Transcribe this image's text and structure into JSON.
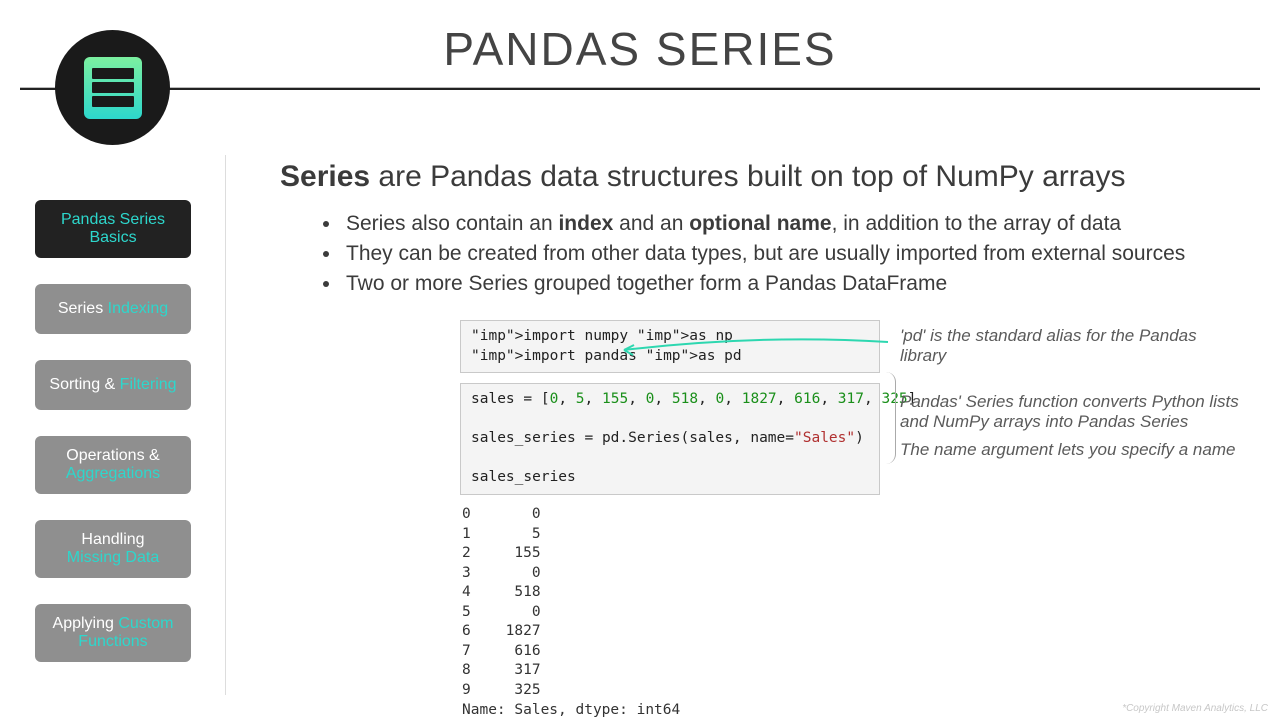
{
  "header": {
    "title": "PANDAS SERIES"
  },
  "sidebar": {
    "items": [
      {
        "line1": "Pandas Series",
        "line2": "Basics"
      },
      {
        "line1": "Series",
        "line2": "Indexing"
      },
      {
        "line1": "Sorting &",
        "line2": "Filtering"
      },
      {
        "line1": "Operations &",
        "line2": "Aggregations"
      },
      {
        "line1": "Handling",
        "line2": "Missing Data"
      },
      {
        "line1": "Applying",
        "line2": "Custom",
        "line3": "Functions"
      }
    ]
  },
  "main": {
    "headline_bold": "Series",
    "headline_rest": " are Pandas data structures built on top of NumPy arrays",
    "bullets": [
      {
        "pre": "Series also contain an ",
        "b1": "index",
        "mid": " and an ",
        "b2": "optional name",
        "post": ", in addition to the array of data"
      },
      {
        "pre": "They can be created from other data types, but are usually imported from external sources"
      },
      {
        "pre": "Two or more Series grouped together form a Pandas DataFrame"
      }
    ]
  },
  "code": {
    "cell1": "import numpy as np\nimport pandas as pd",
    "cell2": "sales = [0, 5, 155, 0, 518, 0, 1827, 616, 317, 325]\n\nsales_series = pd.Series(sales, name=\"Sales\")\n\nsales_series",
    "output": "0       0\n1       5\n2     155\n3       0\n4     518\n5       0\n6    1827\n7     616\n8     317\n9     325\nName: Sales, dtype: int64"
  },
  "annotations": {
    "a1": "'pd' is the standard alias for the Pandas library",
    "a2": "Pandas' Series function converts Python lists and NumPy arrays into Pandas Series",
    "a3": "The name argument lets you specify a name"
  },
  "footer": {
    "copyright": "*Copyright Maven Analytics, LLC"
  }
}
